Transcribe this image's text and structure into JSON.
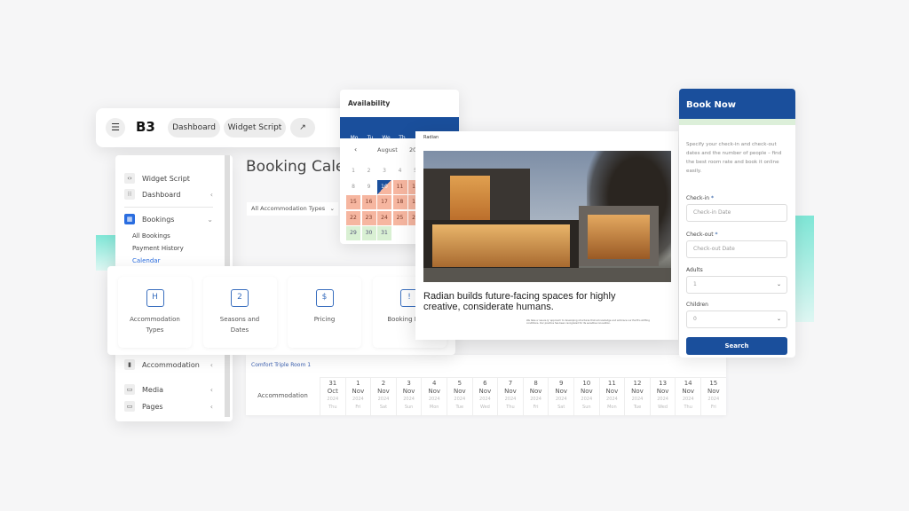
{
  "topbar": {
    "nav": [
      "Dashboard",
      "Widget Script"
    ],
    "logo": "B3"
  },
  "sidebar": {
    "items": [
      {
        "label": "Widget Script",
        "icon": "code-icon"
      },
      {
        "label": "Dashboard",
        "icon": "grid-icon"
      },
      {
        "label": "Bookings",
        "icon": "calendar-icon"
      }
    ],
    "sub_items": [
      "All Bookings",
      "Payment History",
      "Calendar"
    ],
    "lower_items": [
      {
        "label": "Accommodation",
        "icon": "building-icon"
      },
      {
        "label": "Media",
        "icon": "image-icon"
      },
      {
        "label": "Pages",
        "icon": "pages-icon"
      }
    ]
  },
  "main": {
    "title": "Booking Calen",
    "filter": "All Accommodation Types"
  },
  "availability": {
    "title": "Availability",
    "weekdays": [
      "Mo",
      "Tu",
      "We",
      "Th",
      "Fr",
      "Sa",
      "Su"
    ],
    "month": "August",
    "year": "20",
    "days": [
      [
        "1",
        "2",
        "3",
        "4",
        "5"
      ],
      [
        "8",
        "9",
        "10",
        "11",
        "12"
      ],
      [
        "15",
        "16",
        "17",
        "18",
        "19"
      ],
      [
        "22",
        "23",
        "24",
        "25",
        "26"
      ],
      [
        "29",
        "30",
        "31"
      ]
    ],
    "colors": {
      "header": "#1a4f9c",
      "booked": "#f6b6a0",
      "available": "#d9f0d3"
    }
  },
  "website": {
    "brand": "Radian",
    "headline": "Radian builds future-facing spaces for highly creative, considerate humans.",
    "body": "We take a 'sauve-ly' approach to developing structures that acknowledge and embrace our Earth's shifting conditions. Our practice has been recognized for its sensitive innovation."
  },
  "features": [
    {
      "label": "Accommodation Types",
      "icon": "hotel-bell-icon",
      "glyph": "H"
    },
    {
      "label": "Seasons and Dates",
      "icon": "calendar-icon",
      "glyph": "2"
    },
    {
      "label": "Pricing",
      "icon": "price-tag-icon",
      "glyph": "$"
    },
    {
      "label": "Booking Rules",
      "icon": "calendar-alert-icon",
      "glyph": "!"
    }
  ],
  "table": {
    "room": "Comfort Triple Room 1",
    "header": "Accommodation",
    "dates": [
      [
        "31",
        "Oct",
        "2024",
        "Thu"
      ],
      [
        "1",
        "Nov",
        "2024",
        "Fri"
      ],
      [
        "2",
        "Nov",
        "2024",
        "Sat"
      ],
      [
        "3",
        "Nov",
        "2024",
        "Sun"
      ],
      [
        "4",
        "Nov",
        "2024",
        "Mon"
      ],
      [
        "5",
        "Nov",
        "2024",
        "Tue"
      ],
      [
        "6",
        "Nov",
        "2024",
        "Wed"
      ],
      [
        "7",
        "Nov",
        "2024",
        "Thu"
      ],
      [
        "8",
        "Nov",
        "2024",
        "Fri"
      ],
      [
        "9",
        "Nov",
        "2024",
        "Sat"
      ],
      [
        "10",
        "Nov",
        "2024",
        "Sun"
      ],
      [
        "11",
        "Nov",
        "2024",
        "Mon"
      ],
      [
        "12",
        "Nov",
        "2024",
        "Tue"
      ],
      [
        "13",
        "Nov",
        "2024",
        "Wed"
      ],
      [
        "14",
        "Nov",
        "2024",
        "Thu"
      ],
      [
        "15",
        "Nov",
        "2024",
        "Fri"
      ]
    ]
  },
  "book": {
    "title": "Book Now",
    "desc": "Specify your check-in and check-out dates and the number of people – find the best room rate and book it online easily.",
    "checkin_label": "Check-in",
    "checkin_placeholder": "Check-in Date",
    "checkout_label": "Check-out",
    "checkout_placeholder": "Check-out Date",
    "required": "*",
    "adults_label": "Adults",
    "adults_value": "1",
    "children_label": "Children",
    "children_value": "0",
    "search": "Search",
    "accent": "#1a4f9c"
  }
}
